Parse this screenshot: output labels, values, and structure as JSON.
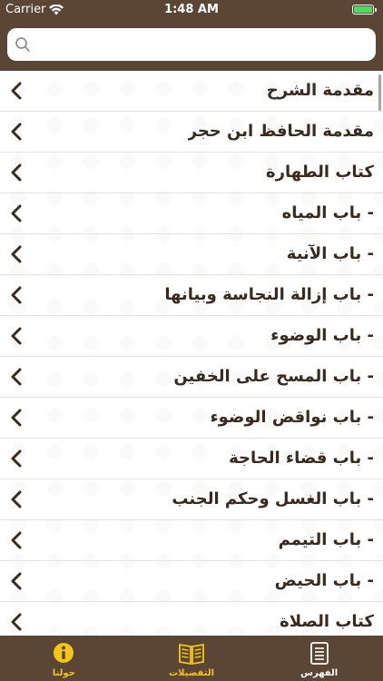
{
  "status_bar": {
    "carrier": "Carrier",
    "time": "1:48 AM",
    "wifi_icon": "wifi-icon",
    "battery_icon": "battery-icon"
  },
  "search": {
    "placeholder": "",
    "icon": "search-icon"
  },
  "list": {
    "items": [
      {
        "label": "مقدمة الشرح"
      },
      {
        "label": "مقدمة الحافظ ابن حجر"
      },
      {
        "label": "كتاب الطهارة"
      },
      {
        "label": "- باب المياه"
      },
      {
        "label": "- باب الآنية"
      },
      {
        "label": "- باب إزالة النجاسة وبيانها"
      },
      {
        "label": "- باب الوضوء"
      },
      {
        "label": "- باب المسح على الخفين"
      },
      {
        "label": "- باب نواقض الوضوء"
      },
      {
        "label": "- باب قضاء الحاجة"
      },
      {
        "label": "- باب الغسل وحكم الجنب"
      },
      {
        "label": "- باب التيمم"
      },
      {
        "label": "- باب الحيض"
      },
      {
        "label": "كتاب الصلاة"
      }
    ]
  },
  "tabs": [
    {
      "label": "حولنا",
      "icon": "info-icon",
      "color": "#f5c518"
    },
    {
      "label": "التفضيلات",
      "icon": "book-icon",
      "color": "#f5c518"
    },
    {
      "label": "الفهرس",
      "icon": "index-list-icon",
      "color": "#ffffff"
    }
  ],
  "colors": {
    "brand_brown": "#5b4636",
    "text_dark": "#3a2a1e",
    "accent_gold": "#f5c518",
    "battery_green": "#4cd964"
  }
}
